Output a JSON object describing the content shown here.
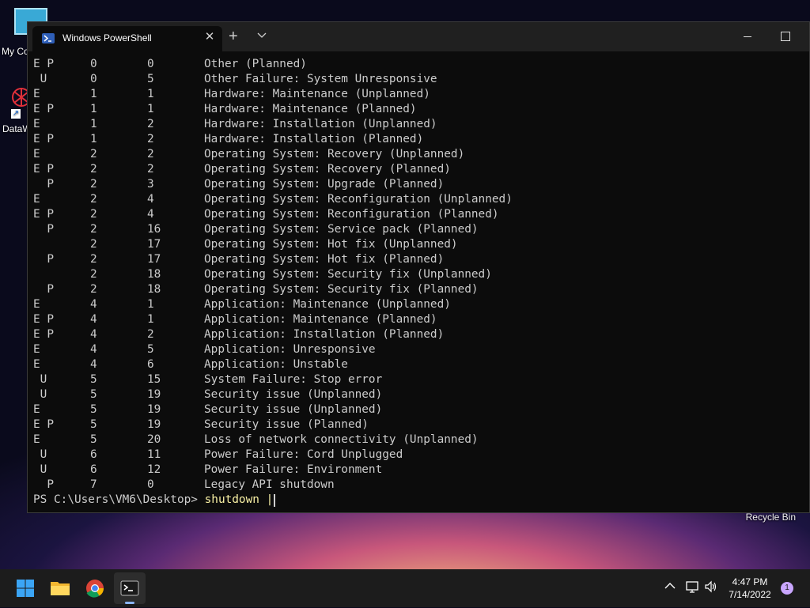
{
  "desktop": {
    "icons": [
      {
        "label": "My Co"
      },
      {
        "label": "DataW"
      }
    ],
    "recycle_bin_label": "Recycle Bin"
  },
  "window": {
    "tab_title": "Windows PowerShell",
    "close_tab_glyph": "✕",
    "new_tab_glyph": "+"
  },
  "console": {
    "rows": [
      {
        "flags": "E P",
        "major": "0",
        "minor": "0",
        "reason": "Other (Planned)"
      },
      {
        "flags": " U",
        "major": "0",
        "minor": "5",
        "reason": "Other Failure: System Unresponsive"
      },
      {
        "flags": "E",
        "major": "1",
        "minor": "1",
        "reason": "Hardware: Maintenance (Unplanned)"
      },
      {
        "flags": "E P",
        "major": "1",
        "minor": "1",
        "reason": "Hardware: Maintenance (Planned)"
      },
      {
        "flags": "E",
        "major": "1",
        "minor": "2",
        "reason": "Hardware: Installation (Unplanned)"
      },
      {
        "flags": "E P",
        "major": "1",
        "minor": "2",
        "reason": "Hardware: Installation (Planned)"
      },
      {
        "flags": "E",
        "major": "2",
        "minor": "2",
        "reason": "Operating System: Recovery (Unplanned)"
      },
      {
        "flags": "E P",
        "major": "2",
        "minor": "2",
        "reason": "Operating System: Recovery (Planned)"
      },
      {
        "flags": "  P",
        "major": "2",
        "minor": "3",
        "reason": "Operating System: Upgrade (Planned)"
      },
      {
        "flags": "E",
        "major": "2",
        "minor": "4",
        "reason": "Operating System: Reconfiguration (Unplanned)"
      },
      {
        "flags": "E P",
        "major": "2",
        "minor": "4",
        "reason": "Operating System: Reconfiguration (Planned)"
      },
      {
        "flags": "  P",
        "major": "2",
        "minor": "16",
        "reason": "Operating System: Service pack (Planned)"
      },
      {
        "flags": "",
        "major": "2",
        "minor": "17",
        "reason": "Operating System: Hot fix (Unplanned)"
      },
      {
        "flags": "  P",
        "major": "2",
        "minor": "17",
        "reason": "Operating System: Hot fix (Planned)"
      },
      {
        "flags": "",
        "major": "2",
        "minor": "18",
        "reason": "Operating System: Security fix (Unplanned)"
      },
      {
        "flags": "  P",
        "major": "2",
        "minor": "18",
        "reason": "Operating System: Security fix (Planned)"
      },
      {
        "flags": "E",
        "major": "4",
        "minor": "1",
        "reason": "Application: Maintenance (Unplanned)"
      },
      {
        "flags": "E P",
        "major": "4",
        "minor": "1",
        "reason": "Application: Maintenance (Planned)"
      },
      {
        "flags": "E P",
        "major": "4",
        "minor": "2",
        "reason": "Application: Installation (Planned)"
      },
      {
        "flags": "E",
        "major": "4",
        "minor": "5",
        "reason": "Application: Unresponsive"
      },
      {
        "flags": "E",
        "major": "4",
        "minor": "6",
        "reason": "Application: Unstable"
      },
      {
        "flags": " U",
        "major": "5",
        "minor": "15",
        "reason": "System Failure: Stop error"
      },
      {
        "flags": " U",
        "major": "5",
        "minor": "19",
        "reason": "Security issue (Unplanned)"
      },
      {
        "flags": "E",
        "major": "5",
        "minor": "19",
        "reason": "Security issue (Unplanned)"
      },
      {
        "flags": "E P",
        "major": "5",
        "minor": "19",
        "reason": "Security issue (Planned)"
      },
      {
        "flags": "E",
        "major": "5",
        "minor": "20",
        "reason": "Loss of network connectivity (Unplanned)"
      },
      {
        "flags": " U",
        "major": "6",
        "minor": "11",
        "reason": "Power Failure: Cord Unplugged"
      },
      {
        "flags": " U",
        "major": "6",
        "minor": "12",
        "reason": "Power Failure: Environment"
      },
      {
        "flags": "  P",
        "major": "7",
        "minor": "0",
        "reason": "Legacy API shutdown"
      }
    ],
    "prompt_path": "PS C:\\Users\\VM6\\Desktop",
    "prompt_symbol": ">",
    "command": " shutdown |"
  },
  "taskbar": {
    "time": "4:47 PM",
    "date": "7/14/2022",
    "notification_count": "1"
  },
  "colors": {
    "console_bg": "#0c0c0c",
    "console_text": "#cccccc",
    "command_text": "#f9f1a5",
    "taskbar_bg": "#1c1c1c"
  }
}
